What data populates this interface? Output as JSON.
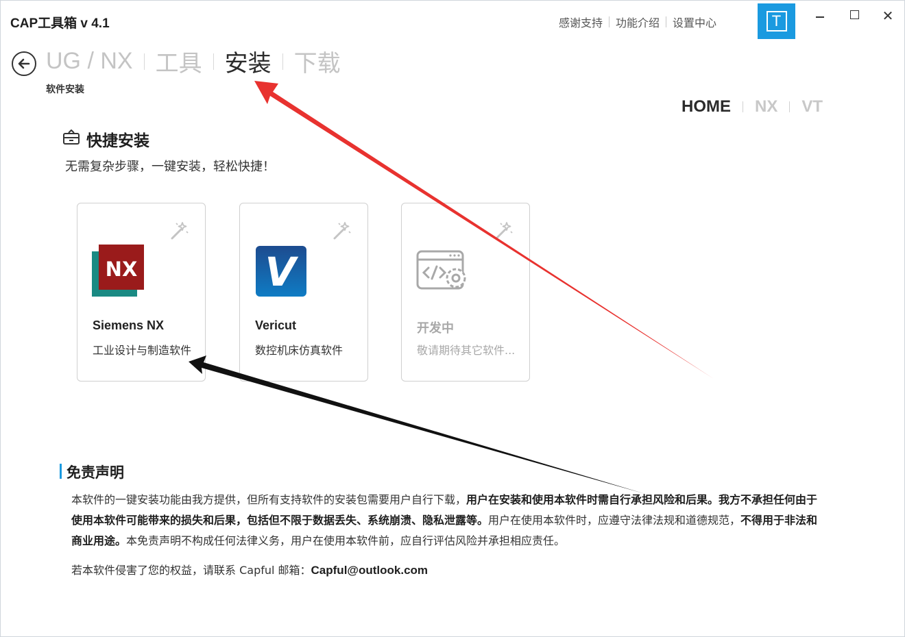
{
  "app": {
    "title": "CAP工具箱 v 4.1"
  },
  "top_links": [
    "感谢支持",
    "功能介绍",
    "设置中心"
  ],
  "avatar": {
    "letter": "T",
    "color": "#1a9ae0"
  },
  "breadcrumb": {
    "items": [
      "UG / NX",
      "工具",
      "安装",
      "下载"
    ],
    "active": "安装",
    "subtitle": "软件安装"
  },
  "right_nav": {
    "items": [
      "HOME",
      "NX",
      "VT"
    ],
    "active": "HOME"
  },
  "quick_install": {
    "title": "快捷安装",
    "desc": "无需复杂步骤，一键安装，轻松快捷！",
    "cards": [
      {
        "name": "Siemens NX",
        "desc": "工业设计与制造软件",
        "logo_text": "NX",
        "icon": "nx-logo-icon"
      },
      {
        "name": "Vericut",
        "desc": "数控机床仿真软件",
        "logo_text": "V",
        "icon": "vericut-logo-icon"
      },
      {
        "name": "开发中",
        "desc": "敬请期待其它软件...",
        "icon": "code-gear-icon"
      }
    ]
  },
  "disclaimer": {
    "title": "免责声明",
    "p1": "本软件的一键安装功能由我方提供，但所有支持软件的安装包需要用户自行下载，",
    "b1": "用户在安装和使用本软件时需自行承担风险和后果。我方不承担任何由于使用本软件可能带来的损失和后果，",
    "b2": "包括但不限于数据丢失、系统崩溃、隐私泄露等。",
    "p2": "用户在使用本软件时，应遵守法律法规和道德规范，",
    "b3": "不得用于非法和商业用途。",
    "p3": "本免责声明不构成任何法律义务，用户在使用本软件前，应自行评估风险并承担相应责任。",
    "contact_prefix": "若本软件侵害了您的权益，请联系 Capful 邮箱：",
    "contact_email": "Capful@outlook.com"
  },
  "colors": {
    "accent": "#1a9ae0",
    "red_arrow": "#e8322f",
    "black_arrow": "#111111"
  }
}
